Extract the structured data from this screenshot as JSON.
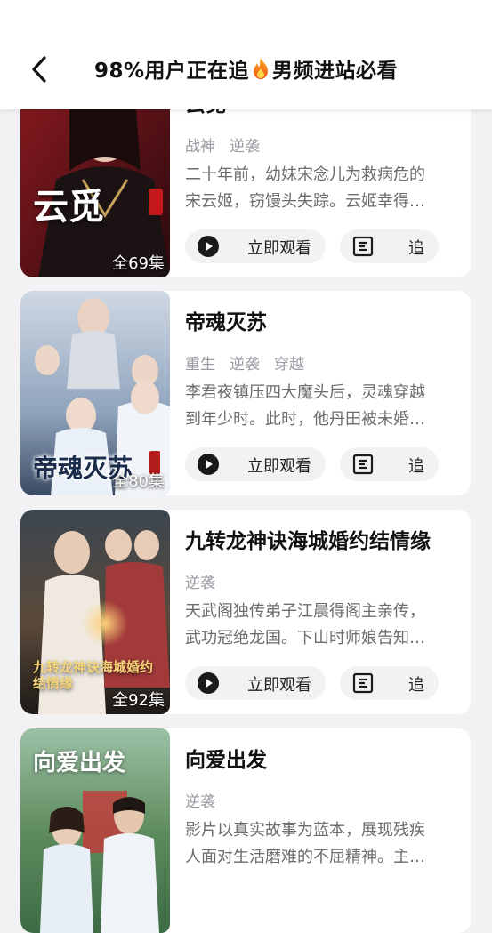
{
  "header": {
    "title_before": "98%用户正在追",
    "title_after": "男频进站必看"
  },
  "dramas": [
    {
      "title": "云觅",
      "tags": [
        "战神",
        "逆袭"
      ],
      "desc_line1": "二十年前，幼妹宋念儿为救病危的",
      "desc_line2": "宋云姬，窃馒头失踪。云姬幸得…",
      "episodes": "全69集",
      "poster_text": "云觅",
      "watch_label": "立即观看",
      "follow_label": "追"
    },
    {
      "title": "帝魂灭苏",
      "tags": [
        "重生",
        "逆袭",
        "穿越"
      ],
      "desc_line1": "李君夜镇压四大魔头后，灵魂穿越",
      "desc_line2": "到年少时。此时，他丹田被未婚…",
      "episodes": "全80集",
      "poster_text": "帝魂灭苏",
      "watch_label": "立即观看",
      "follow_label": "追"
    },
    {
      "title": "九转龙神诀海城婚约结情缘",
      "tags": [
        "逆袭"
      ],
      "desc_line1": "天武阁独传弟子江晨得阁主亲传，",
      "desc_line2": "武功冠绝龙国。下山时师娘告知…",
      "episodes": "全92集",
      "poster_text": "九转龙神诀海城婚约结情缘",
      "watch_label": "立即观看",
      "follow_label": "追"
    },
    {
      "title": "向爱出发",
      "tags": [
        "逆袭"
      ],
      "desc_line1": "影片以真实故事为蓝本，展现残疾",
      "desc_line2": "人面对生活磨难的不屈精神。主…",
      "episodes": "",
      "poster_text": "向爱出发",
      "watch_label": "立即观看",
      "follow_label": "追"
    }
  ],
  "colors": {
    "background": "#f2f2f4",
    "card": "#ffffff",
    "tag": "#9a9aa2",
    "desc": "#6b6b70"
  },
  "icons": {
    "back": "chevron-left-icon",
    "flame": "fire-icon",
    "play": "play-circle-icon",
    "follow": "list-box-icon"
  }
}
